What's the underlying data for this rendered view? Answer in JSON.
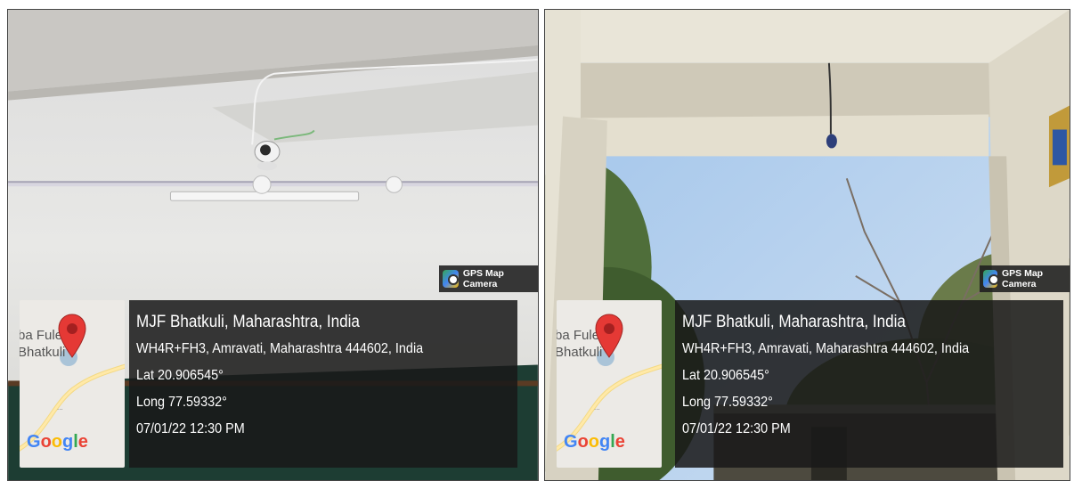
{
  "photos": [
    {
      "badge": {
        "label": "GPS Map Camera"
      },
      "map": {
        "place_lines": [
          "ba Fule",
          "Bhatkuli"
        ],
        "logo_text": "Google"
      },
      "info": {
        "title": "MJF Bhatkuli, Maharashtra, India",
        "address": "WH4R+FH3, Amravati, Maharashtra 444602, India",
        "lat": "Lat 20.906545°",
        "long": "Long 77.59332°",
        "datetime": "07/01/22 12:30 PM"
      }
    },
    {
      "badge": {
        "label": "GPS Map Camera"
      },
      "map": {
        "place_lines": [
          "ba Fule",
          "Bhatkuli"
        ],
        "logo_text": "Google"
      },
      "info": {
        "title": "MJF Bhatkuli, Maharashtra, India",
        "address": "WH4R+FH3, Amravati, Maharashtra 444602, India",
        "lat": "Lat 20.906545°",
        "long": "Long 77.59332°",
        "datetime": "07/01/22 12:30 PM"
      }
    }
  ],
  "colors": {
    "google_blue": "#4285F4",
    "google_red": "#EA4335",
    "google_yellow": "#FBBC05",
    "google_green": "#34A853",
    "pin_red": "#E53935"
  }
}
